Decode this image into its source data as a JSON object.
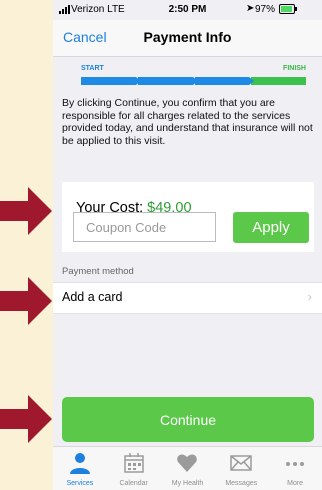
{
  "status": {
    "carrier": "Verizon LTE",
    "time": "2:50 PM",
    "battery": "97%"
  },
  "nav": {
    "cancel": "Cancel",
    "title": "Payment Info"
  },
  "progress": {
    "start": "START",
    "finish": "FINISH"
  },
  "disclaimer": "By clicking Continue, you confirm that you are responsible for all charges related to the services provided today, and understand that insurance will not be applied to this visit.",
  "cost": {
    "label": "Your Cost:",
    "amount": "$49.00"
  },
  "coupon": {
    "placeholder": "Coupon Code",
    "value": ""
  },
  "apply_label": "Apply",
  "payment": {
    "section_label": "Payment method",
    "add_card": "Add a card"
  },
  "continue_label": "Continue",
  "tabs": [
    {
      "label": "Services",
      "icon": "person-icon",
      "active": true
    },
    {
      "label": "Calendar",
      "icon": "calendar-icon",
      "active": false
    },
    {
      "label": "My Health",
      "icon": "heart-icon",
      "active": false
    },
    {
      "label": "Messages",
      "icon": "envelope-icon",
      "active": false
    },
    {
      "label": "More",
      "icon": "more-dots-icon",
      "active": false
    }
  ],
  "colors": {
    "accent_blue": "#1d7fe0",
    "button_green": "#5bc84a",
    "amount_green": "#2f9e36",
    "annotation_arrow": "#a0182e",
    "page_background": "#fbf1d6"
  }
}
